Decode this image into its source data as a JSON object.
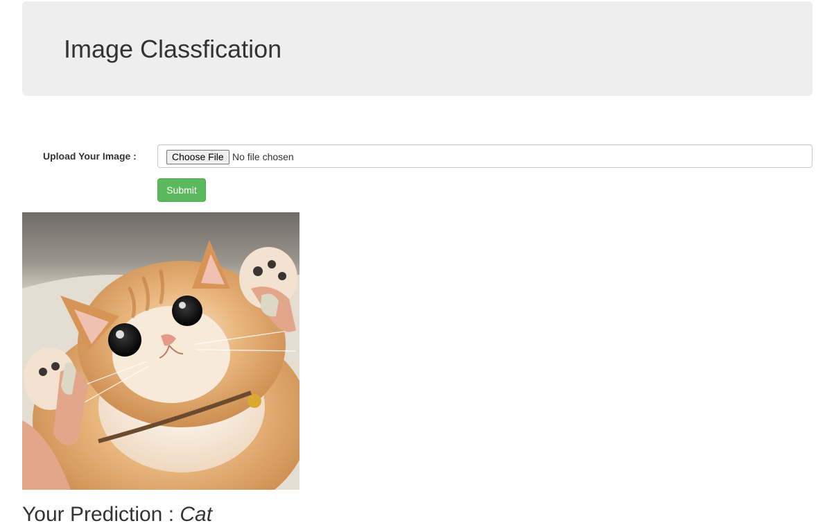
{
  "header": {
    "title": "Image Classfication"
  },
  "upload_form": {
    "label": "Upload Your Image :",
    "choose_file_label": "Choose File",
    "file_status": "No file chosen",
    "submit_label": "Submit"
  },
  "preview": {
    "subject": "cat photo"
  },
  "result": {
    "prefix": "Your Prediction : ",
    "label": "Cat"
  },
  "colors": {
    "header_background": "#eeeeee",
    "submit_button": "#5cb85c",
    "text": "#333333"
  }
}
